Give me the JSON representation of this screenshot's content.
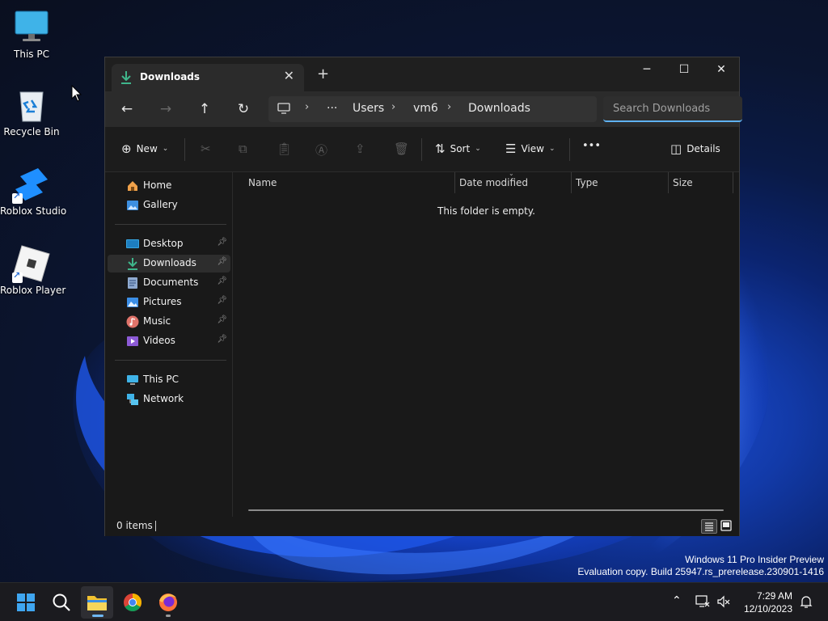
{
  "desktop": {
    "icons": [
      {
        "label": "This PC"
      },
      {
        "label": "Recycle Bin"
      },
      {
        "label": "Roblox Studio"
      },
      {
        "label": "Roblox Player"
      }
    ]
  },
  "explorer": {
    "tab_title": "Downloads",
    "navigation": {
      "back": "back-arrow",
      "forward": "forward-arrow",
      "up": "up-arrow",
      "refresh": "refresh"
    },
    "breadcrumb": [
      "Users",
      "vm6",
      "Downloads"
    ],
    "breadcrumb_overflow": "···",
    "search_placeholder": "Search Downloads",
    "commands": {
      "new": "New",
      "sort": "Sort",
      "view": "View",
      "more": "•••",
      "details": "Details"
    },
    "sidebar": {
      "top": [
        {
          "label": "Home"
        },
        {
          "label": "Gallery"
        }
      ],
      "quick_access": [
        {
          "label": "Desktop",
          "pinned": true
        },
        {
          "label": "Downloads",
          "pinned": true,
          "selected": true
        },
        {
          "label": "Documents",
          "pinned": true
        },
        {
          "label": "Pictures",
          "pinned": true
        },
        {
          "label": "Music",
          "pinned": true
        },
        {
          "label": "Videos",
          "pinned": true
        }
      ],
      "devices": [
        {
          "label": "This PC"
        },
        {
          "label": "Network"
        }
      ]
    },
    "columns": [
      "Name",
      "Date modified",
      "Type",
      "Size"
    ],
    "empty_message": "This folder is empty.",
    "status": "0 items"
  },
  "watermark": {
    "line1": "Windows 11 Pro Insider Preview",
    "line2": "Evaluation copy. Build 25947.rs_prerelease.230901-1416"
  },
  "taskbar": {
    "apps": [
      "start",
      "search",
      "file-explorer",
      "chrome",
      "firefox"
    ],
    "clock": {
      "time": "7:29 AM",
      "date": "12/10/2023"
    }
  },
  "colors": {
    "accent": "#5fb2f2",
    "window_bg": "#191919",
    "download_green": "#3fb68b"
  }
}
